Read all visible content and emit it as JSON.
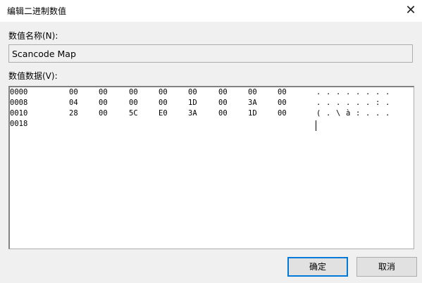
{
  "title": "编辑二进制数值",
  "name_label": "数值名称(N):",
  "name_value": "Scancode Map",
  "data_label": "数值数据(V):",
  "rows": [
    {
      "offset": "0000",
      "bytes": [
        "00",
        "00",
        "00",
        "00",
        "00",
        "00",
        "00",
        "00"
      ],
      "ascii": [
        ".",
        ".",
        ".",
        ".",
        ".",
        ".",
        ".",
        "."
      ]
    },
    {
      "offset": "0008",
      "bytes": [
        "04",
        "00",
        "00",
        "00",
        "1D",
        "00",
        "3A",
        "00"
      ],
      "ascii": [
        ".",
        ".",
        ".",
        ".",
        ".",
        ".",
        ":",
        "."
      ]
    },
    {
      "offset": "0010",
      "bytes": [
        "28",
        "00",
        "5C",
        "E0",
        "3A",
        "00",
        "1D",
        "00"
      ],
      "ascii": [
        "(",
        ".",
        "\\",
        "à",
        ":",
        ".",
        ".",
        "."
      ]
    },
    {
      "offset": "0018",
      "bytes": [],
      "ascii": []
    }
  ],
  "buttons": {
    "ok": "确定",
    "cancel": "取消"
  },
  "colors": {
    "accent": "#0078d7"
  }
}
